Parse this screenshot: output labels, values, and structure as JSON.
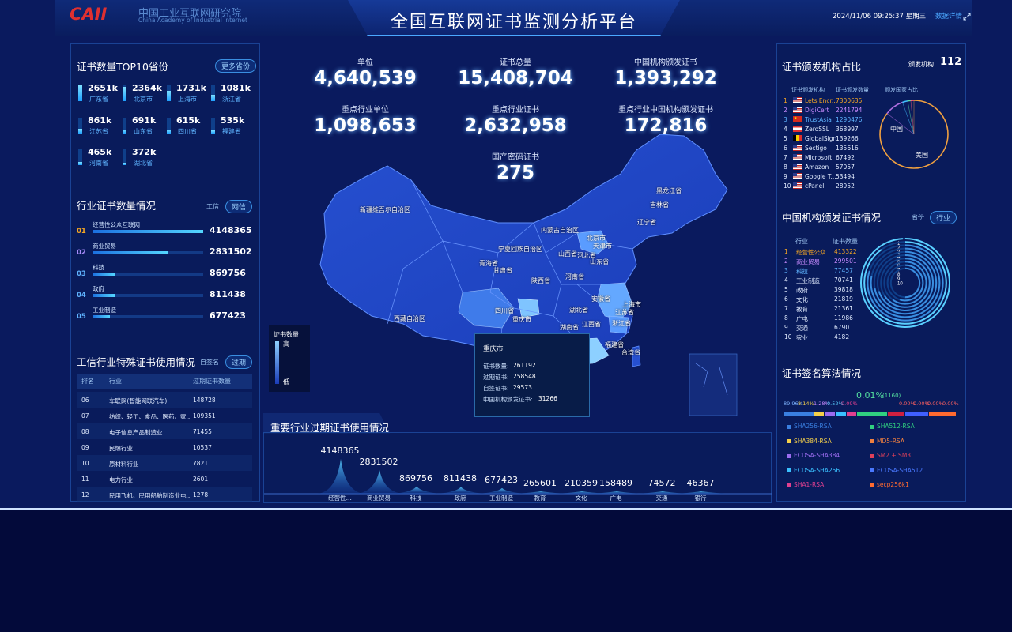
{
  "header": {
    "logo_text": "CAII",
    "org_cn": "中国工业互联网研究院",
    "org_en": "China Academy of Industrial Internet",
    "title": "全国互联网证书监测分析平台",
    "datetime": "2024/11/06 09:25:37 星期三",
    "details_link": "数据详情"
  },
  "colors": {
    "background": "#0a1a5e",
    "accent": "#4ba8ff",
    "accent_cyan": "#54d6ff",
    "rank_orange": "#f5a623",
    "rank_purple": "#a78bfa",
    "rank_blue": "#5fb4ff"
  },
  "top_stats": [
    {
      "label": "单位",
      "value": "4,640,539"
    },
    {
      "label": "证书总量",
      "value": "15,408,704"
    },
    {
      "label": "中国机构颁发证书",
      "value": "1,393,292"
    },
    {
      "label": "重点行业单位",
      "value": "1,098,653"
    },
    {
      "label": "重点行业证书",
      "value": "2,632,958"
    },
    {
      "label": "重点行业中国机构颁发证书",
      "value": "172,816"
    },
    {
      "label": "国产密码证书",
      "value": "275"
    }
  ],
  "province_panel": {
    "title": "证书数量TOP10省份",
    "more_button": "更多省份",
    "items": [
      {
        "value": "2651k",
        "name": "广东省",
        "level": 1.0
      },
      {
        "value": "2364k",
        "name": "北京市",
        "level": 0.89
      },
      {
        "value": "1731k",
        "name": "上海市",
        "level": 0.65
      },
      {
        "value": "1081k",
        "name": "浙江省",
        "level": 0.41
      },
      {
        "value": "861k",
        "name": "江苏省",
        "level": 0.32
      },
      {
        "value": "691k",
        "name": "山东省",
        "level": 0.26
      },
      {
        "value": "615k",
        "name": "四川省",
        "level": 0.23
      },
      {
        "value": "535k",
        "name": "福建省",
        "level": 0.2
      },
      {
        "value": "465k",
        "name": "河南省",
        "level": 0.18
      },
      {
        "value": "372k",
        "name": "湖北省",
        "level": 0.14
      }
    ]
  },
  "industry_panel": {
    "title": "行业证书数量情况",
    "filter_label": "工信",
    "filter_button": "网信",
    "items": [
      {
        "rank": "01",
        "name": "经营性公众互联网",
        "value": "4148365",
        "ratio": 1.0
      },
      {
        "rank": "02",
        "name": "商业贸易",
        "value": "2831502",
        "ratio": 0.68
      },
      {
        "rank": "03",
        "name": "科技",
        "value": "869756",
        "ratio": 0.21
      },
      {
        "rank": "04",
        "name": "政府",
        "value": "811438",
        "ratio": 0.2
      },
      {
        "rank": "05",
        "name": "工业制造",
        "value": "677423",
        "ratio": 0.16
      }
    ]
  },
  "special_panel": {
    "title": "工信行业特殊证书使用情况",
    "filter_label": "自签名",
    "filter_button": "过期",
    "columns": [
      "排名",
      "行业",
      "过期证书数量"
    ],
    "rows": [
      {
        "rank": "06",
        "industry": "车联网(智能网联汽车)",
        "count": "148728"
      },
      {
        "rank": "07",
        "industry": "纺织、轻工、食品、医药、家...",
        "count": "109351"
      },
      {
        "rank": "08",
        "industry": "电子信息产品制造业",
        "count": "71455"
      },
      {
        "rank": "09",
        "industry": "民爆行业",
        "count": "10537"
      },
      {
        "rank": "10",
        "industry": "原材料行业",
        "count": "7821"
      },
      {
        "rank": "11",
        "industry": "电力行业",
        "count": "2601"
      },
      {
        "rank": "12",
        "industry": "民用飞机、民用船舶制造业电...",
        "count": "1278"
      }
    ]
  },
  "map": {
    "legend_title": "证书数量",
    "legend_high": "高",
    "legend_low": "低",
    "labels": [
      "新疆维吾尔自治区",
      "西藏自治区",
      "青海省",
      "甘肃省",
      "内蒙古自治区",
      "宁夏回族自治区",
      "陕西省",
      "山西省",
      "河北省",
      "北京市",
      "天津市",
      "山东省",
      "河南省",
      "四川省",
      "重庆市",
      "湖北省",
      "安徽省",
      "江苏省",
      "上海市",
      "浙江省",
      "江西省",
      "湖南省",
      "福建省",
      "台湾省",
      "黑龙江省",
      "吉林省",
      "辽宁省"
    ],
    "tooltip": {
      "name": "重庆市",
      "lines": [
        {
          "label": "证书数量:",
          "value": "261192"
        },
        {
          "label": "过期证书:",
          "value": "258548"
        },
        {
          "label": "自签证书:",
          "value": "29573"
        },
        {
          "label": "中国机构颁发证书:",
          "value": "31266"
        }
      ]
    }
  },
  "bottom_chart": {
    "title": "重要行业过期证书使用情况",
    "chart_data": {
      "type": "area",
      "categories": [
        "经营性...",
        "商业贸易",
        "科技",
        "政府",
        "工业制造",
        "教育",
        "文化",
        "广电",
        "交通",
        "银行"
      ],
      "values": [
        4148365,
        2831502,
        869756,
        811438,
        677423,
        265601,
        210359,
        158489,
        74572,
        46367
      ]
    }
  },
  "ca_panel": {
    "title": "证书颁发机构占比",
    "total_label": "颁发机构",
    "total_value": "112",
    "columns": [
      "证书颁发机构",
      "证书颁发数量",
      "颁发国家占比"
    ],
    "rows": [
      {
        "rank": "1",
        "name": "Lets Encr...",
        "count": "7300635",
        "flag": "us"
      },
      {
        "rank": "2",
        "name": "DigiCert",
        "count": "2241794",
        "flag": "us"
      },
      {
        "rank": "3",
        "name": "TrustAsia",
        "count": "1290476",
        "flag": "cn"
      },
      {
        "rank": "4",
        "name": "ZeroSSL",
        "count": "368997",
        "flag": "at"
      },
      {
        "rank": "5",
        "name": "GlobalSign",
        "count": "139266",
        "flag": "be"
      },
      {
        "rank": "6",
        "name": "Sectigo",
        "count": "135616",
        "flag": "us"
      },
      {
        "rank": "7",
        "name": "Microsoft",
        "count": "67492",
        "flag": "us"
      },
      {
        "rank": "8",
        "name": "Amazon",
        "count": "57057",
        "flag": "us"
      },
      {
        "rank": "9",
        "name": "Google T...",
        "count": "53494",
        "flag": "us"
      },
      {
        "rank": "10",
        "name": "cPanel",
        "count": "28952",
        "flag": "us"
      }
    ],
    "pie": {
      "type": "pie",
      "labels": [
        "美国",
        "中国"
      ],
      "slices": [
        {
          "name": "美国",
          "share": 0.855,
          "color": "#f0a040"
        },
        {
          "name": "中国",
          "share": 0.09,
          "color": "#b06ee0"
        },
        {
          "name": "其他1",
          "share": 0.025,
          "color": "#40c0ff"
        },
        {
          "name": "其他2",
          "share": 0.015,
          "color": "#5ee0a0"
        },
        {
          "name": "其他3",
          "share": 0.015,
          "color": "#ff6080"
        }
      ]
    }
  },
  "cn_org_panel": {
    "title": "中国机构颁发证书情况",
    "filter_label": "省份",
    "filter_button": "行业",
    "columns": [
      "行业",
      "证书数量"
    ],
    "rows": [
      {
        "rank": "1",
        "name": "经营性公众...",
        "count": "413322",
        "color": "#f5a623"
      },
      {
        "rank": "2",
        "name": "商业贸易",
        "count": "299501",
        "color": "#c98bff"
      },
      {
        "rank": "3",
        "name": "科技",
        "count": "77457",
        "color": "#5fb4ff"
      },
      {
        "rank": "4",
        "name": "工业制造",
        "count": "70741",
        "color": "#e2ecff"
      },
      {
        "rank": "5",
        "name": "政府",
        "count": "39818",
        "color": "#e2ecff"
      },
      {
        "rank": "6",
        "name": "文化",
        "count": "21819",
        "color": "#e2ecff"
      },
      {
        "rank": "7",
        "name": "教育",
        "count": "21361",
        "color": "#e2ecff"
      },
      {
        "rank": "8",
        "name": "广电",
        "count": "11986",
        "color": "#e2ecff"
      },
      {
        "rank": "9",
        "name": "交通",
        "count": "6790",
        "color": "#e2ecff"
      },
      {
        "rank": "10",
        "name": "农业",
        "count": "4182",
        "color": "#e2ecff"
      }
    ],
    "ring_labels": [
      "1",
      "2",
      "3",
      "4",
      "5",
      "6",
      "7",
      "8",
      "9",
      "10"
    ]
  },
  "algo_panel": {
    "title": "证书签名算法情况",
    "top_label": "0.01%",
    "top_count": "(1160)",
    "percent_labels": [
      "89.96%",
      "8.14%",
      "1.28%",
      "0.52%",
      "0.09%",
      "0.00%",
      "0.00%",
      "0.00%",
      "0.00%"
    ],
    "bar_colors": [
      "#3a7fe0",
      "#f5d04a",
      "#9b6cf0",
      "#3ac0ff",
      "#e04090",
      "#30d080",
      "#d02040",
      "#4060ff",
      "#ff6a30"
    ],
    "bar_shares": [
      0.18,
      0.06,
      0.06,
      0.06,
      0.06,
      0.18,
      0.1,
      0.14,
      0.16
    ],
    "legend": [
      {
        "name": "SHA256-RSA",
        "color": "#3a7fe0"
      },
      {
        "name": "SHA512-RSA",
        "color": "#30d080"
      },
      {
        "name": "SHA384-RSA",
        "color": "#f5d04a"
      },
      {
        "name": "MD5-RSA",
        "color": "#f08040"
      },
      {
        "name": "ECDSA-SHA384",
        "color": "#9b6cf0"
      },
      {
        "name": "SM2 + SM3",
        "color": "#e0405a"
      },
      {
        "name": "ECDSA-SHA256",
        "color": "#3ac0ff"
      },
      {
        "name": "ECDSA-SHA512",
        "color": "#4a78ff"
      },
      {
        "name": "SHA1-RSA",
        "color": "#e04090"
      },
      {
        "name": "secp256k1",
        "color": "#ff6a30"
      }
    ]
  }
}
